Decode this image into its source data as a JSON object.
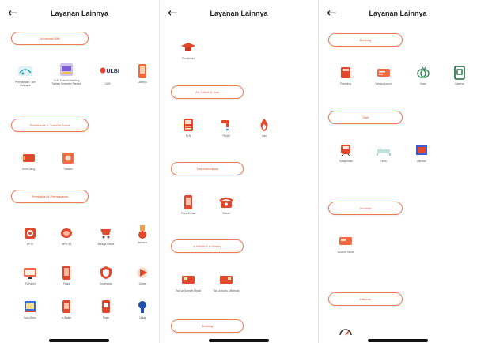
{
  "colors": {
    "accent": "#e0562d",
    "pill_border": "#ee7a53",
    "text": "#222222"
  },
  "screens": [
    {
      "title": "Layanan Lainnya",
      "back_icon": "back-arrow-icon",
      "sections": [
        {
          "label": "Universal Bills",
          "items": [
            {
              "label": "Pembayaran Tiket Maskapai",
              "icon": "airplane-icon"
            },
            {
              "label": "ULBI Student Matching System Semester Pendek",
              "icon": "student-system-icon"
            },
            {
              "label": "ULBI",
              "icon": "ulbi-logo-icon"
            },
            {
              "label": "Lainnya",
              "icon": "phone-card-icon"
            }
          ]
        },
        {
          "label": "Remittance & Transfer Dana",
          "items": [
            {
              "label": "Kirim Uang",
              "icon": "send-money-icon"
            },
            {
              "label": "Transfer",
              "icon": "transfer-icon"
            }
          ]
        },
        {
          "label": "Pembelian & Pembayaran",
          "items": [
            {
              "label": "BPJS",
              "icon": "bpjs-icon"
            },
            {
              "label": "MPN G3",
              "icon": "coin-icon"
            },
            {
              "label": "Belanja Online",
              "icon": "cart-icon"
            },
            {
              "label": "Asuransi",
              "icon": "insurance-icon"
            },
            {
              "label": "TV Kabel",
              "icon": "tv-icon"
            },
            {
              "label": "Pulsa",
              "icon": "phone-icon"
            },
            {
              "label": "Kesehatan",
              "icon": "shield-icon"
            },
            {
              "label": "Game",
              "icon": "play-icon"
            },
            {
              "label": "Buku Buku",
              "icon": "book-icon"
            },
            {
              "label": "e-Wallet",
              "icon": "wallet-icon"
            },
            {
              "label": "Pajak",
              "icon": "tax-icon"
            },
            {
              "label": "Zakat",
              "icon": "donation-icon"
            }
          ]
        }
      ]
    },
    {
      "title": "Layanan Lainnya",
      "back_icon": "back-arrow-icon",
      "sections": [
        {
          "label": "",
          "items": [
            {
              "label": "Pendidikan",
              "icon": "graduation-cap-icon"
            }
          ]
        },
        {
          "label": "Air, Listrik & Gas",
          "items": [
            {
              "label": "PLN",
              "icon": "electric-meter-icon"
            },
            {
              "label": "PDAM",
              "icon": "water-tap-icon"
            },
            {
              "label": "Gas",
              "icon": "gas-flame-icon"
            }
          ]
        },
        {
          "label": "Telekomunikasi",
          "items": [
            {
              "label": "Pulsa & Data",
              "icon": "phone-icon"
            },
            {
              "label": "Telkom",
              "icon": "telephone-icon"
            }
          ]
        },
        {
          "label": "e-Wallet & e-Money",
          "items": [
            {
              "label": "Top Up Dompet Digital",
              "icon": "wallet-card-icon"
            },
            {
              "label": "Top Up Kartu Elektronik",
              "icon": "e-card-icon"
            }
          ]
        },
        {
          "label": "Banking",
          "items": []
        }
      ]
    },
    {
      "title": "Layanan Lainnya",
      "back_icon": "back-arrow-icon",
      "sections": [
        {
          "label": "Banking",
          "items": [
            {
              "label": "Rekening",
              "icon": "bank-book-icon"
            },
            {
              "label": "Virtual Account",
              "icon": "va-card-icon"
            },
            {
              "label": "Kartu",
              "icon": "coins-icon"
            },
            {
              "label": "Lainnya",
              "icon": "bank-app-icon"
            }
          ]
        },
        {
          "label": "Tiket",
          "items": [
            {
              "label": "Transportasi",
              "icon": "train-icon"
            },
            {
              "label": "Hotel",
              "icon": "bed-icon"
            },
            {
              "label": "Hiburan",
              "icon": "ticket-icon"
            }
          ]
        },
        {
          "label": "Voucher",
          "items": [
            {
              "label": "Voucher Game",
              "icon": "gift-card-icon"
            }
          ]
        },
        {
          "label": "Hiburan",
          "items": [
            {
              "label": "",
              "icon": "speedometer-icon"
            }
          ]
        }
      ]
    }
  ]
}
